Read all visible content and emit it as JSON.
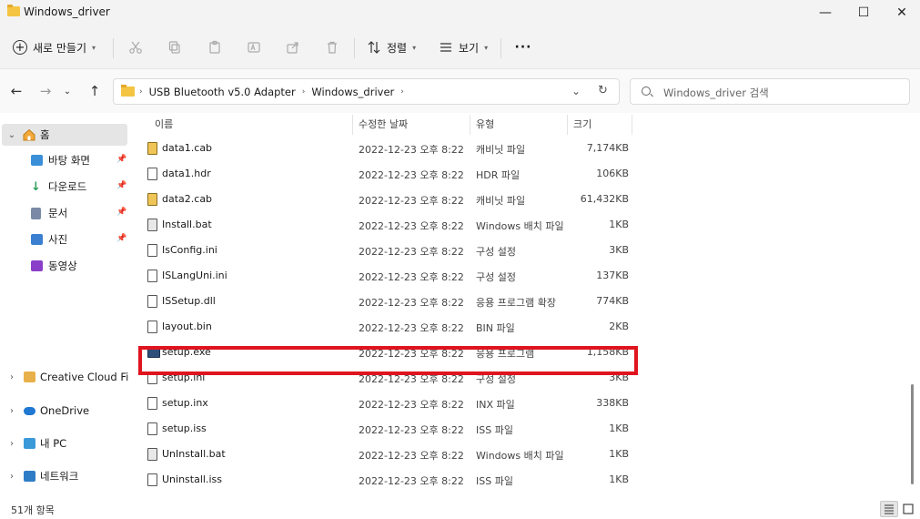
{
  "window": {
    "title": "Windows_driver",
    "minimize": "—",
    "maximize": "☐",
    "close": "✕"
  },
  "toolbar": {
    "new_label": "새로 만들기",
    "sort_label": "정렬",
    "view_label": "보기",
    "more_label": "···"
  },
  "address": {
    "crumbs": [
      "USB Bluetooth v5.0 Adapter",
      "Windows_driver"
    ],
    "search_placeholder": "Windows_driver 검색"
  },
  "sidebar": {
    "home": "홈",
    "quick": [
      {
        "label": "바탕 화면",
        "color": "#3a8fd8"
      },
      {
        "label": "다운로드",
        "color": "#2a9c5a"
      },
      {
        "label": "문서",
        "color": "#7a8aa6"
      },
      {
        "label": "사진",
        "color": "#3a7fd0"
      },
      {
        "label": "동영상",
        "color": "#8a3fc8"
      }
    ],
    "groups": [
      {
        "label": "Creative Cloud Files",
        "color": "#e8b04a"
      },
      {
        "label": "OneDrive",
        "color": "#1f78d1"
      },
      {
        "label": "내 PC",
        "color": "#3a9ad9"
      },
      {
        "label": "네트워크",
        "color": "#2f7cc6"
      }
    ]
  },
  "columns": {
    "name": "이름",
    "date": "수정한 날짜",
    "type": "유형",
    "size": "크기"
  },
  "files": [
    {
      "name": "data1.cab",
      "date": "2022-12-23 오후 8:22",
      "type": "캐비닛 파일",
      "size": "7,174KB",
      "icon": "cab"
    },
    {
      "name": "data1.hdr",
      "date": "2022-12-23 오후 8:22",
      "type": "HDR 파일",
      "size": "106KB",
      "icon": "file"
    },
    {
      "name": "data2.cab",
      "date": "2022-12-23 오후 8:22",
      "type": "캐비닛 파일",
      "size": "61,432KB",
      "icon": "cab"
    },
    {
      "name": "Install.bat",
      "date": "2022-12-23 오후 8:22",
      "type": "Windows 배치 파일",
      "size": "1KB",
      "icon": "bat"
    },
    {
      "name": "IsConfig.ini",
      "date": "2022-12-23 오후 8:22",
      "type": "구성 설정",
      "size": "3KB",
      "icon": "ini"
    },
    {
      "name": "ISLangUni.ini",
      "date": "2022-12-23 오후 8:22",
      "type": "구성 설정",
      "size": "137KB",
      "icon": "ini"
    },
    {
      "name": "ISSetup.dll",
      "date": "2022-12-23 오후 8:22",
      "type": "응용 프로그램 확장",
      "size": "774KB",
      "icon": "dll"
    },
    {
      "name": "layout.bin",
      "date": "2022-12-23 오후 8:22",
      "type": "BIN 파일",
      "size": "2KB",
      "icon": "file"
    },
    {
      "name": "setup.exe",
      "date": "2022-12-23 오후 8:22",
      "type": "응용 프로그램",
      "size": "1,158KB",
      "icon": "exe"
    },
    {
      "name": "setup.ini",
      "date": "2022-12-23 오후 8:22",
      "type": "구성 설정",
      "size": "3KB",
      "icon": "ini"
    },
    {
      "name": "setup.inx",
      "date": "2022-12-23 오후 8:22",
      "type": "INX 파일",
      "size": "338KB",
      "icon": "file"
    },
    {
      "name": "setup.iss",
      "date": "2022-12-23 오후 8:22",
      "type": "ISS 파일",
      "size": "1KB",
      "icon": "file"
    },
    {
      "name": "UnInstall.bat",
      "date": "2022-12-23 오후 8:22",
      "type": "Windows 배치 파일",
      "size": "1KB",
      "icon": "bat"
    },
    {
      "name": "Uninstall.iss",
      "date": "2022-12-23 오후 8:22",
      "type": "ISS 파일",
      "size": "1KB",
      "icon": "file"
    }
  ],
  "highlight_color": "#e0141e",
  "status": {
    "count": "51개 항목"
  }
}
